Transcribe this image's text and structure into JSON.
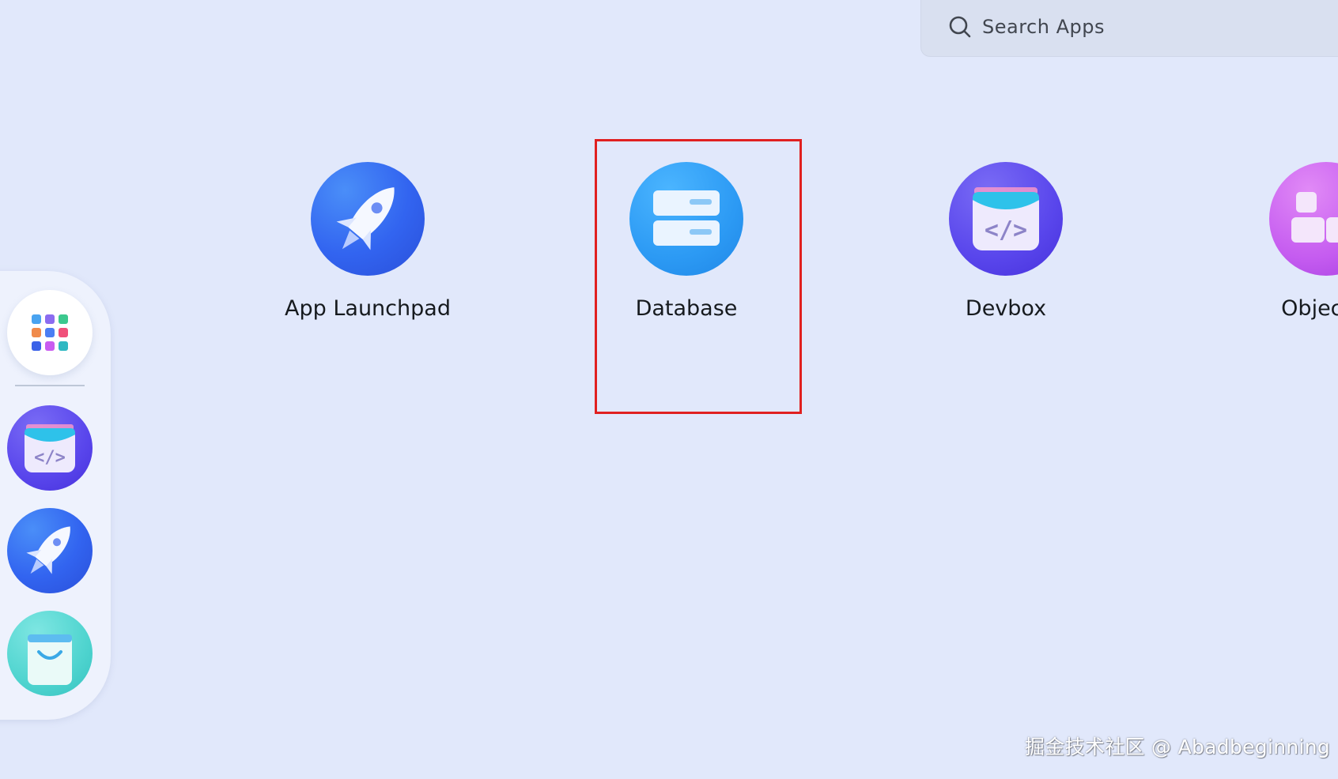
{
  "search": {
    "placeholder": "Search Apps"
  },
  "apps": [
    {
      "label": "App Launchpad",
      "icon": "rocket-icon"
    },
    {
      "label": "Database",
      "icon": "database-icon"
    },
    {
      "label": "Devbox",
      "icon": "code-folder-icon"
    },
    {
      "label": "Object S",
      "icon": "blocks-icon"
    }
  ],
  "dock": {
    "items": [
      {
        "icon": "app-grid-icon"
      },
      {
        "icon": "code-folder-icon"
      },
      {
        "icon": "rocket-icon"
      },
      {
        "icon": "shopping-bag-icon"
      }
    ]
  },
  "highlight": {
    "target": "Database",
    "color": "#e02020"
  },
  "watermark": {
    "text": "掘金技术社区 @ Abadbeginning"
  },
  "colors": {
    "background": "#e1e8fb",
    "launchpad": "#3264f0",
    "database": "#2c9af4",
    "devbox": "#5946ec",
    "object_storage": "#c55cf0"
  }
}
